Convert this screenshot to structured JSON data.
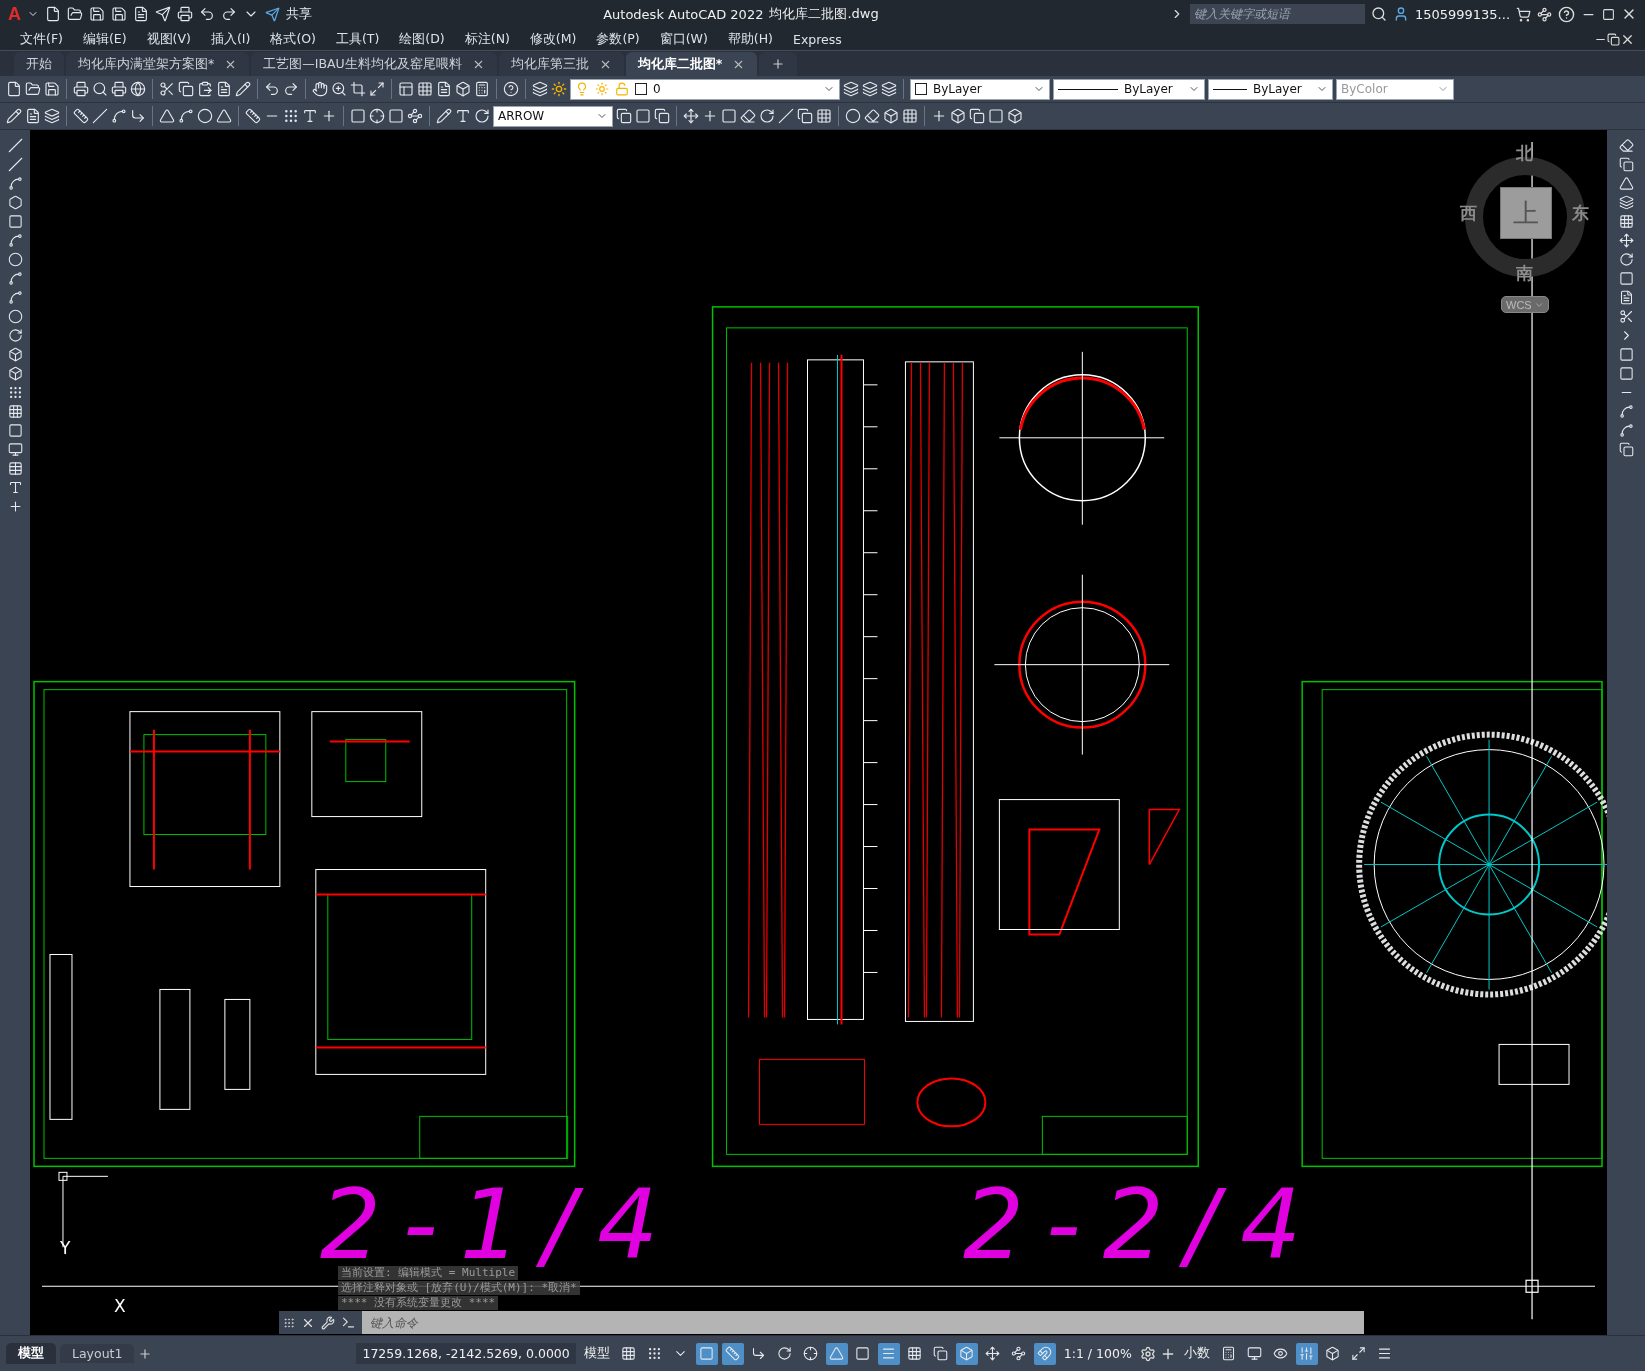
{
  "title_bar": {
    "logo": "A",
    "quick_access_label": "共享",
    "app_title": "Autodesk AutoCAD 2022",
    "file_name": "均化库二批图.dwg",
    "search": {
      "placeholder": "键入关键字或短语"
    },
    "user": "1505999135..."
  },
  "menu": [
    "文件(F)",
    "编辑(E)",
    "视图(V)",
    "插入(I)",
    "格式(O)",
    "工具(T)",
    "绘图(D)",
    "标注(N)",
    "修改(M)",
    "参数(P)",
    "窗口(W)",
    "帮助(H)",
    "Express"
  ],
  "tabs": [
    {
      "label": "开始",
      "selected": false,
      "closable": false
    },
    {
      "label": "均化库内满堂架方案图*",
      "selected": false,
      "closable": true
    },
    {
      "label": "工艺图—IBAU生料均化及窑尾喂料",
      "selected": false,
      "closable": true
    },
    {
      "label": "均化库第三批",
      "selected": false,
      "closable": true
    },
    {
      "label": "均化库二批图*",
      "selected": true,
      "closable": true
    }
  ],
  "properties": {
    "layer": "0",
    "color_setting": "ByLayer",
    "linetype": "ByLayer",
    "lineweight": "ByLayer",
    "plot_style": {
      "value": "ByColor",
      "disabled": true
    },
    "dim_style": "ARROW"
  },
  "viewcube": {
    "north": "北",
    "south": "南",
    "east": "东",
    "west": "西",
    "face": "上",
    "ucs": "WCS"
  },
  "canvas": {
    "labels": [
      "2-1/4",
      "2-2/4"
    ],
    "axis_x": "X",
    "axis_y": "Y"
  },
  "command_line": {
    "history": [
      "当前设置: 编辑模式 = Multiple",
      "选择注释对象或 [放弃(U)/模式(M)]: *取消*",
      "**** 没有系统变量更改 ****"
    ],
    "placeholder": "键入命令"
  },
  "layout_tabs": [
    {
      "label": "模型",
      "selected": true
    },
    {
      "label": "Layout1",
      "selected": false
    }
  ],
  "status_bar": {
    "coordinates": "17259.1268, -2142.5269, 0.0000",
    "space": "模型",
    "scale": "1:1 / 100%",
    "units": "小数",
    "toggles": [
      {
        "on": false
      },
      {
        "on": false
      },
      {
        "on": false
      },
      {
        "on": true
      },
      {
        "on": true
      },
      {
        "on": false
      },
      {
        "on": false
      },
      {
        "on": false
      },
      {
        "on": true
      },
      {
        "on": false
      },
      {
        "on": true
      },
      {
        "on": false
      },
      {
        "on": false
      },
      {
        "on": true
      },
      {
        "on": false
      },
      {
        "on": false
      },
      {
        "on": true
      }
    ],
    "end_toggles": [
      {
        "on": false
      },
      {
        "on": false
      },
      {
        "on": false
      },
      {
        "on": true
      },
      {
        "on": false
      },
      {
        "on": false
      },
      {
        "on": false
      }
    ]
  }
}
